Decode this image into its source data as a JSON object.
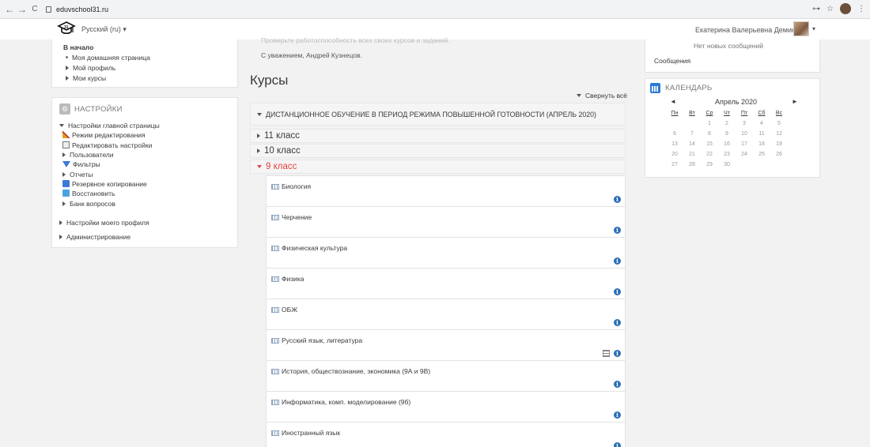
{
  "browser": {
    "back": "←",
    "forward": "→",
    "reload": "C",
    "url": "eduvschool31.ru",
    "key": "⊶",
    "star": "☆",
    "menu": "⋮"
  },
  "navbar": {
    "language": "Русский (ru) ▾",
    "user": "Екатерина Валерьевна Демина",
    "caret": "▾"
  },
  "nav": {
    "home": "В начало",
    "items": [
      "Моя домашняя страница",
      "Мой профиль",
      "Мои курсы"
    ]
  },
  "settings": {
    "title": "НАСТРОЙКИ",
    "front_page": "Настройки главной страницы",
    "edit_mode": "Режим редактирования",
    "edit_settings": "Редактировать настройки",
    "users": "Пользователи",
    "filters": "Фильтры",
    "reports": "Отчеты",
    "backup": "Резервное копирование",
    "restore": "Восстановить",
    "question_bank": "Банк вопросов",
    "my_profile": "Настройки моего профиля",
    "admin": "Администрирование"
  },
  "main": {
    "faded_text": "Проверьте работоспособность всех своих курсов и заданий.",
    "regards": "С уважением, Андрей Кузнецов.",
    "heading": "Курсы",
    "collapse_all": "Свернуть всё",
    "category": "ДИСТАНЦИОННОЕ ОБУЧЕНИЕ В ПЕРИОД РЕЖИМА ПОВЫШЕННОЙ ГОТОВНОСТИ (АПРЕЛЬ 2020)",
    "subcats": [
      "11 класс",
      "10 класс",
      "9 класс"
    ],
    "courses": [
      "Биология",
      "Черчение",
      "Физическая культура",
      "Физика",
      "ОБЖ",
      "Русский язык, литература",
      "История, обществознание, экономика (9А и 9В)",
      "Информатика, комп. моделирование (9б)",
      "Иностранный язык"
    ],
    "info_glyph": "i"
  },
  "messages": {
    "none": "Нет новых сообщений",
    "link": "Сообщения"
  },
  "calendar": {
    "title": "КАЛЕНДАРЬ",
    "prev": "◄",
    "next": "►",
    "month": "Апрель 2020",
    "weekdays": [
      "Пн",
      "Вт",
      "Ср",
      "Чт",
      "Пт",
      "Сб",
      "Вс"
    ],
    "weeks": [
      [
        "",
        "",
        "1",
        "2",
        "3",
        "4",
        "5"
      ],
      [
        "6",
        "7",
        "8",
        "9",
        "10",
        "11",
        "12"
      ],
      [
        "13",
        "14",
        "15",
        "16",
        "17",
        "18",
        "19"
      ],
      [
        "20",
        "21",
        "22",
        "23",
        "24",
        "25",
        "26"
      ],
      [
        "27",
        "28",
        "29",
        "30",
        "",
        "",
        ""
      ]
    ]
  }
}
